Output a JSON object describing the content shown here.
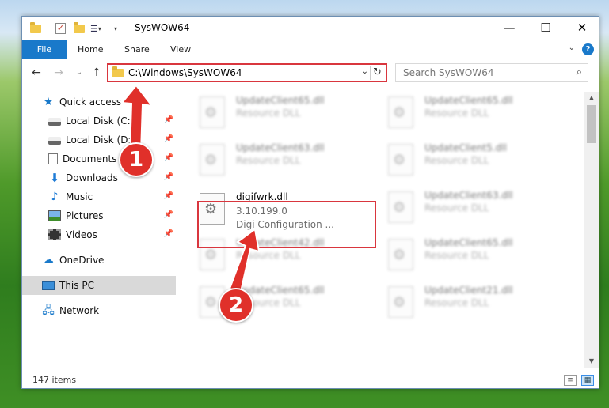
{
  "window": {
    "title": "SysWOW64",
    "minimize": "—",
    "maximize": "☐",
    "close": "✕"
  },
  "quick_access_toolbar": {
    "dropdown": "▾"
  },
  "ribbon": {
    "file_tab": "File",
    "tabs": [
      "Home",
      "Share",
      "View"
    ],
    "collapse": "⌄",
    "help": "?"
  },
  "nav": {
    "back": "←",
    "forward": "→",
    "recent": "⌄",
    "up": "↑"
  },
  "address_bar": {
    "path": "C:\\Windows\\SysWOW64",
    "dropdown": "⌄",
    "refresh": "↻"
  },
  "search": {
    "placeholder": "Search SysWOW64",
    "icon": "⌕"
  },
  "sidebar": {
    "items": [
      {
        "label": "Quick access",
        "icon": "star-icon",
        "pinned": false
      },
      {
        "label": "Local Disk (C:)",
        "icon": "disk-icon",
        "pinned": true
      },
      {
        "label": "Local Disk (D:)",
        "icon": "disk-icon",
        "pinned": true
      },
      {
        "label": "Documents",
        "icon": "documents-icon",
        "pinned": true
      },
      {
        "label": "Downloads",
        "icon": "download-icon",
        "pinned": true
      },
      {
        "label": "Music",
        "icon": "music-icon",
        "pinned": true
      },
      {
        "label": "Pictures",
        "icon": "pictures-icon",
        "pinned": true
      },
      {
        "label": "Videos",
        "icon": "videos-icon",
        "pinned": true
      },
      {
        "label": "OneDrive",
        "icon": "cloud-icon",
        "pinned": false
      },
      {
        "label": "This PC",
        "icon": "computer-icon",
        "pinned": false,
        "selected": true
      },
      {
        "label": "Network",
        "icon": "network-icon",
        "pinned": false
      }
    ],
    "pin_glyph": "📌"
  },
  "files": {
    "left_column": [
      {
        "name": "UpdateClient65.dll",
        "line2": "Resource DLL"
      },
      {
        "name": "UpdateClient63.dll",
        "line2": "Resource DLL"
      },
      {
        "name": "digifwrk.dll",
        "line2": "3.10.199.0",
        "line3": "Digi Configuration ...",
        "highlighted": true
      },
      {
        "name": "UpdateClient42.dll",
        "line2": "Resource DLL"
      },
      {
        "name": "UpdateClient65.dll",
        "line2": "Resource DLL"
      }
    ],
    "right_column": [
      {
        "name": "UpdateClient65.dll",
        "line2": "Resource DLL"
      },
      {
        "name": "UpdateClient5.dll",
        "line2": "Resource DLL"
      },
      {
        "name": "UpdateClient63.dll",
        "line2": "Resource DLL"
      },
      {
        "name": "UpdateClient65.dll",
        "line2": "Resource DLL"
      },
      {
        "name": "UpdateClient21.dll",
        "line2": "Resource DLL"
      }
    ]
  },
  "scrollbar": {
    "up": "▲",
    "down": "▼"
  },
  "status": {
    "items_count": "147 items",
    "details_view": "≡",
    "tiles_view": "▦"
  },
  "annotations": {
    "step1": "1",
    "step2": "2",
    "color": "#e0302a"
  }
}
